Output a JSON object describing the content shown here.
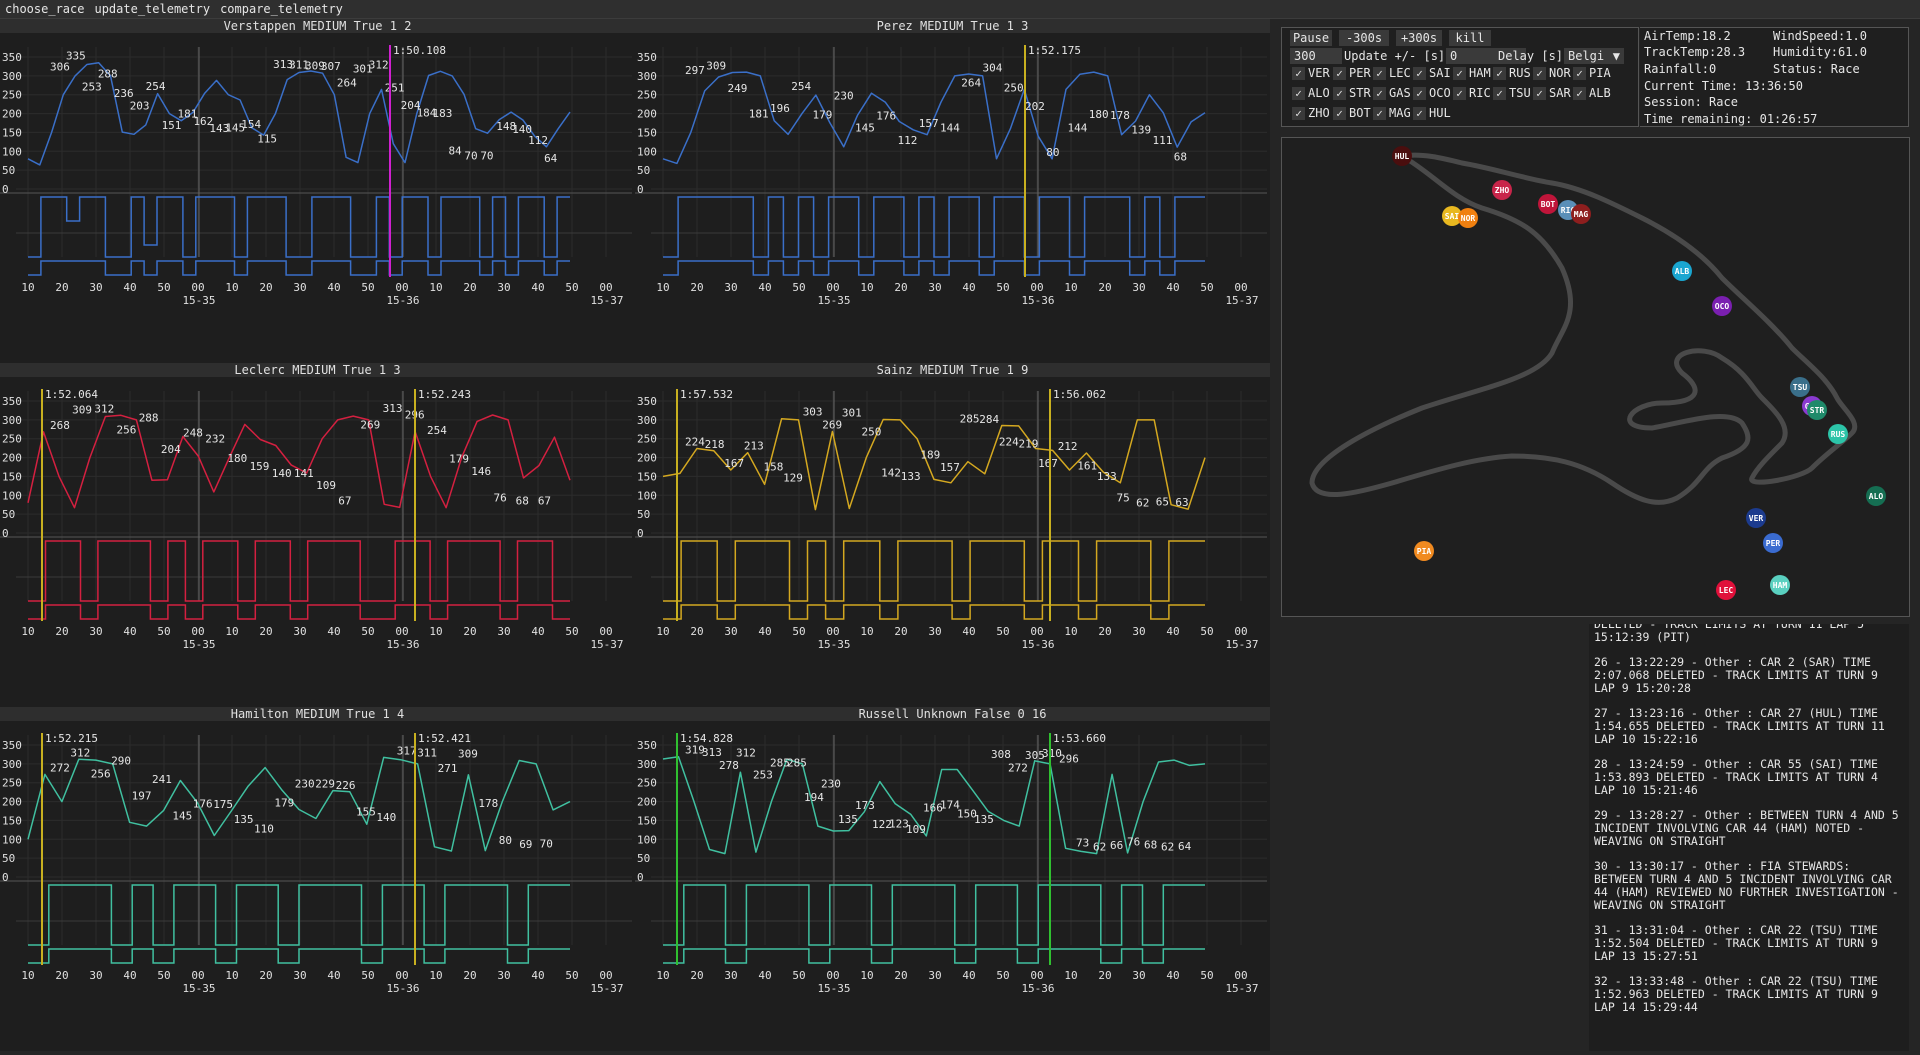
{
  "menu": [
    "choose_race",
    "update_telemetry",
    "compare_telemetry"
  ],
  "controls": {
    "pause": "Pause",
    "minus": "-300s",
    "plus": "+300s",
    "kill": "kill",
    "step_value": "300",
    "update_label": "Update +/- [s]",
    "update_value": "0",
    "delay_label": "Delay [s]",
    "race_select": "Belgi"
  },
  "drivers": [
    {
      "code": "VER",
      "checked": true
    },
    {
      "code": "PER",
      "checked": true
    },
    {
      "code": "LEC",
      "checked": true
    },
    {
      "code": "SAI",
      "checked": true
    },
    {
      "code": "HAM",
      "checked": true
    },
    {
      "code": "RUS",
      "checked": true
    },
    {
      "code": "NOR",
      "checked": true
    },
    {
      "code": "PIA",
      "checked": true
    },
    {
      "code": "ALO",
      "checked": true
    },
    {
      "code": "STR",
      "checked": true
    },
    {
      "code": "GAS",
      "checked": true
    },
    {
      "code": "OCO",
      "checked": true
    },
    {
      "code": "RIC",
      "checked": true
    },
    {
      "code": "TSU",
      "checked": true
    },
    {
      "code": "SAR",
      "checked": true
    },
    {
      "code": "ALB",
      "checked": true
    },
    {
      "code": "ZHO",
      "checked": true
    },
    {
      "code": "BOT",
      "checked": true
    },
    {
      "code": "MAG",
      "checked": true
    },
    {
      "code": "HUL",
      "checked": true
    }
  ],
  "weather": {
    "air_temp": "AirTemp:18.2",
    "track_temp": "TrackTemp:28.3",
    "rainfall": "Rainfall:0",
    "current_time": "Current Time: 13:36:50",
    "session": "Session: Race",
    "time_remaining": "Time remaining: 01:26:57",
    "wind_speed": "WindSpeed:1.0",
    "humidity": "Humidity:61.0",
    "status": "Status: Race"
  },
  "track_markers": [
    {
      "code": "HUL",
      "color": "#4a0e0e"
    },
    {
      "code": "ZHO",
      "color": "#c8254a"
    },
    {
      "code": "BOT",
      "color": "#c0153a"
    },
    {
      "code": "RIC",
      "color": "#5a8fb8"
    },
    {
      "code": "MAG",
      "color": "#8e1e1e"
    },
    {
      "code": "SAI",
      "color": "#e8b820"
    },
    {
      "code": "NOR",
      "color": "#f08010"
    },
    {
      "code": "ALB",
      "color": "#1aa6d0"
    },
    {
      "code": "OCO",
      "color": "#7a1fb0"
    },
    {
      "code": "TSU",
      "color": "#3a6f8a"
    },
    {
      "code": "GAS",
      "color": "#8a3ad0"
    },
    {
      "code": "STR",
      "color": "#1f8a6a"
    },
    {
      "code": "RUS",
      "color": "#2cc4a8"
    },
    {
      "code": "ALO",
      "color": "#156e52"
    },
    {
      "code": "VER",
      "color": "#1c3b8e"
    },
    {
      "code": "PER",
      "color": "#3a6bd0"
    },
    {
      "code": "PIA",
      "color": "#f08a20"
    },
    {
      "code": "HAM",
      "color": "#5ad0c0"
    },
    {
      "code": "LEC",
      "color": "#e0103a"
    }
  ],
  "log": [
    "DELETED - TRACK LIMITS AT TURN 11 LAP 5\n15:12:39 (PIT)",
    "26 - 13:22:29 - Other : CAR 2 (SAR) TIME\n2:07.068 DELETED - TRACK LIMITS AT TURN 9\nLAP 9 15:20:28",
    "27 - 13:23:16 - Other : CAR 27 (HUL) TIME\n1:54.655 DELETED - TRACK LIMITS AT TURN 11\nLAP 10 15:22:16",
    "28 - 13:24:59 - Other : CAR 55 (SAI) TIME\n1:53.893 DELETED - TRACK LIMITS AT TURN 4\nLAP 10 15:21:46",
    "29 - 13:28:27 - Other : BETWEEN TURN 4 AND 5\nINCIDENT INVOLVING CAR 44 (HAM) NOTED -\nWEAVING ON STRAIGHT",
    "30 - 13:30:17 - Other : FIA STEWARDS:\nBETWEEN TURN 4 AND 5 INCIDENT INVOLVING CAR\n44 (HAM) REVIEWED NO FURTHER INVESTIGATION -\nWEAVING ON STRAIGHT",
    "31 - 13:31:04 - Other : CAR 22 (TSU) TIME\n1:52.504 DELETED - TRACK LIMITS AT TURN 9\nLAP 13 15:27:51",
    "32 - 13:33:48 - Other : CAR 22 (TSU) TIME\n1:52.963 DELETED - TRACK LIMITS AT TURN 9\nLAP 14 15:29:44"
  ],
  "axis": {
    "x_ticks": [
      "10",
      "20",
      "30",
      "40",
      "50",
      "00",
      "10",
      "20",
      "30",
      "40",
      "50",
      "00",
      "10",
      "20",
      "30",
      "40",
      "50",
      "00"
    ],
    "minute_labels": [
      "15-35",
      "15-36",
      "15-37"
    ],
    "y_ticks": [
      "350",
      "300",
      "250",
      "200",
      "150",
      "100",
      "50",
      "0"
    ]
  },
  "chart_data": [
    {
      "title": "Verstappen MEDIUM True 1 2",
      "color": "#3a6fc8",
      "laptimes": [
        "1:50.108"
      ],
      "marker_color": "#d020d0",
      "speed_labels": [
        "306",
        "335",
        "253",
        "288",
        "236",
        "203",
        "254",
        "151",
        "181",
        "162",
        "143",
        "145",
        "154",
        "115",
        "313",
        "311",
        "309",
        "307",
        "264",
        "301",
        "312",
        "251",
        "204",
        "184",
        "183",
        "84",
        "70",
        "70",
        "148",
        "140",
        "112",
        "64"
      ],
      "speed_profile": [
        80,
        64,
        150,
        250,
        300,
        330,
        335,
        300,
        151,
        145,
        170,
        253,
        200,
        181,
        203,
        254,
        288,
        250,
        236,
        162,
        143,
        200,
        290,
        309,
        313,
        307,
        250,
        84,
        70,
        200,
        264,
        120,
        70,
        200,
        301,
        312,
        300,
        251,
        160,
        148,
        184,
        204,
        183,
        140,
        112,
        160,
        204
      ],
      "throttle_profile": [
        0,
        1,
        1,
        0.6,
        1,
        1,
        0,
        0,
        1,
        0.2,
        1,
        1,
        0,
        1,
        1,
        1,
        0,
        1,
        1,
        1,
        0,
        0,
        1,
        1,
        1,
        0,
        0,
        1,
        0,
        1,
        1,
        0,
        1,
        1,
        1,
        0,
        1,
        0,
        1,
        1,
        0,
        1
      ]
    },
    {
      "title": "Perez MEDIUM True 1 3",
      "color": "#3a6fc8",
      "laptimes": [
        "1:52.175"
      ],
      "marker_color": "#c8b020",
      "speed_labels": [
        "297",
        "309",
        "249",
        "181",
        "196",
        "254",
        "179",
        "230",
        "145",
        "176",
        "112",
        "157",
        "144",
        "264",
        "304",
        "250",
        "202",
        "80",
        "144",
        "180",
        "178",
        "139",
        "111",
        "68"
      ],
      "speed_profile": [
        80,
        68,
        150,
        260,
        297,
        309,
        310,
        300,
        181,
        145,
        200,
        249,
        176,
        112,
        196,
        254,
        230,
        179,
        157,
        144,
        230,
        300,
        305,
        300,
        80,
        160,
        264,
        140,
        80,
        264,
        304,
        310,
        300,
        144,
        180,
        250,
        202,
        111,
        178,
        202
      ],
      "throttle_profile": [
        0,
        1,
        1,
        1,
        1,
        1,
        0,
        1,
        0,
        1,
        0,
        1,
        1,
        0,
        1,
        1,
        0,
        1,
        0,
        1,
        1,
        0,
        1,
        1,
        0,
        1,
        1,
        0,
        1,
        1,
        1,
        0,
        1,
        0,
        1,
        1
      ]
    },
    {
      "title": "Leclerc MEDIUM True 1 3",
      "color": "#d42040",
      "laptimes": [
        "1:52.064",
        "1:52.243"
      ],
      "marker_color": "#c8b020",
      "speed_labels": [
        "268",
        "309",
        "312",
        "256",
        "288",
        "204",
        "248",
        "232",
        "180",
        "159",
        "140",
        "141",
        "109",
        "67",
        "269",
        "313",
        "296",
        "254",
        "179",
        "146",
        "76",
        "68",
        "67"
      ],
      "speed_profile": [
        80,
        268,
        150,
        67,
        200,
        309,
        312,
        300,
        140,
        141,
        256,
        204,
        109,
        200,
        288,
        248,
        232,
        180,
        159,
        250,
        300,
        310,
        300,
        76,
        68,
        269,
        150,
        67,
        200,
        296,
        313,
        300,
        146,
        179,
        254,
        140
      ],
      "throttle_profile": [
        0,
        1,
        1,
        0,
        1,
        1,
        1,
        0,
        1,
        0,
        1,
        1,
        0,
        1,
        1,
        0,
        1,
        1,
        1,
        0,
        0,
        1,
        1,
        0,
        1,
        1,
        1,
        0,
        1,
        1,
        0
      ]
    },
    {
      "title": "Sainz MEDIUM True 1 9",
      "color": "#d4a820",
      "laptimes": [
        "1:57.532",
        "1:56.062"
      ],
      "marker_color": "#c8b020",
      "speed_labels": [
        "224",
        "218",
        "167",
        "213",
        "158",
        "129",
        "303",
        "269",
        "301",
        "250",
        "142",
        "133",
        "189",
        "157",
        "285",
        "284",
        "224",
        "219",
        "167",
        "212",
        "161",
        "133",
        "75",
        "62",
        "65",
        "63"
      ],
      "speed_profile": [
        150,
        158,
        224,
        218,
        167,
        213,
        129,
        303,
        300,
        62,
        269,
        65,
        200,
        301,
        300,
        250,
        142,
        133,
        189,
        157,
        285,
        284,
        224,
        219,
        167,
        212,
        161,
        133,
        300,
        300,
        75,
        63,
        200
      ],
      "throttle_profile": [
        0,
        1,
        1,
        0,
        1,
        1,
        1,
        0,
        1,
        0,
        1,
        1,
        0,
        1,
        1,
        1,
        0,
        1,
        1,
        1,
        0,
        1,
        1,
        0,
        1,
        1,
        1,
        0,
        1,
        1
      ]
    },
    {
      "title": "Hamilton MEDIUM True 1 4",
      "color": "#40c0a0",
      "laptimes": [
        "1:52.215",
        "1:52.421"
      ],
      "marker_color": "#c8b020",
      "speed_labels": [
        "272",
        "312",
        "256",
        "290",
        "197",
        "241",
        "145",
        "176",
        "175",
        "135",
        "110",
        "179",
        "230",
        "229",
        "226",
        "155",
        "140",
        "317",
        "311",
        "271",
        "309",
        "178",
        "80",
        "69",
        "70"
      ],
      "speed_profile": [
        100,
        272,
        200,
        312,
        310,
        300,
        145,
        135,
        176,
        256,
        197,
        110,
        175,
        241,
        290,
        230,
        179,
        155,
        229,
        226,
        140,
        317,
        311,
        300,
        80,
        69,
        271,
        70,
        200,
        309,
        300,
        178,
        200
      ],
      "throttle_profile": [
        0,
        1,
        1,
        1,
        0,
        1,
        0,
        1,
        1,
        0,
        1,
        1,
        0,
        1,
        1,
        1,
        0,
        1,
        1,
        0,
        1,
        1,
        1,
        0,
        1,
        1
      ]
    },
    {
      "title": "Russell Unknown False 0 16",
      "color": "#40c0a0",
      "laptimes": [
        "1:54.828",
        "1:53.660"
      ],
      "marker_color": "#30c030",
      "speed_labels": [
        "319",
        "313",
        "278",
        "312",
        "253",
        "285",
        "285",
        "194",
        "230",
        "135",
        "173",
        "122",
        "123",
        "109",
        "166",
        "174",
        "150",
        "135",
        "308",
        "272",
        "305",
        "310",
        "296",
        "73",
        "62",
        "66",
        "76",
        "68",
        "62",
        "64"
      ],
      "speed_profile": [
        313,
        319,
        200,
        73,
        62,
        278,
        66,
        200,
        312,
        300,
        135,
        122,
        123,
        173,
        253,
        194,
        166,
        109,
        285,
        285,
        230,
        174,
        150,
        135,
        308,
        300,
        76,
        68,
        62,
        272,
        64,
        200,
        305,
        310,
        296,
        300
      ],
      "throttle_profile": [
        0,
        1,
        1,
        0,
        1,
        1,
        1,
        0,
        1,
        1,
        0,
        1,
        1,
        1,
        0,
        1,
        1,
        0,
        1,
        1,
        1,
        0,
        1,
        0,
        1,
        1
      ]
    }
  ]
}
